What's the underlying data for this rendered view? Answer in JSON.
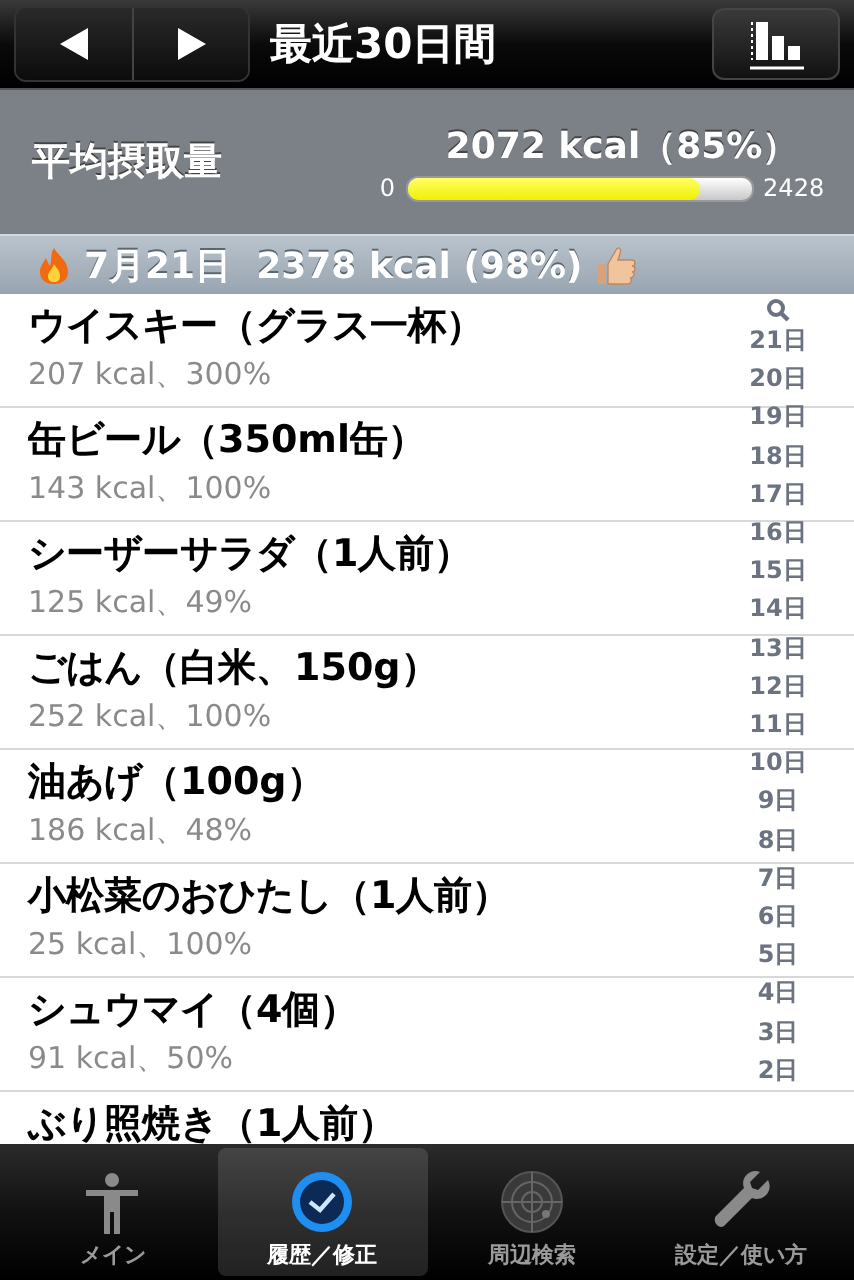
{
  "nav_bar": {
    "title": "最近30日間"
  },
  "summary": {
    "label": "平均摂取量",
    "value": "2072 kcal（85%）",
    "min": "0",
    "max": "2428",
    "level": 0.85
  },
  "section": {
    "title": "7月21日  2378 kcal (98%)"
  },
  "items": [
    {
      "name": "ウイスキー（グラス一杯）",
      "detail": "207 kcal、300%"
    },
    {
      "name": "缶ビール（350ml缶）",
      "detail": "143 kcal、100%"
    },
    {
      "name": "シーザーサラダ（1人前）",
      "detail": "125 kcal、49%"
    },
    {
      "name": "ごはん（白米、150g）",
      "detail": "252 kcal、100%"
    },
    {
      "name": "油あげ（100g）",
      "detail": "186 kcal、48%"
    },
    {
      "name": "小松菜のおひたし（1人前）",
      "detail": "25 kcal、100%"
    },
    {
      "name": "シュウマイ（4個）",
      "detail": "91 kcal、50%"
    },
    {
      "name": "ぶり照焼き（1人前）"
    }
  ],
  "index": [
    "21日",
    "20日",
    "19日",
    "18日",
    "17日",
    "16日",
    "15日",
    "14日",
    "13日",
    "12日",
    "11日",
    "10日",
    "9日",
    "8日",
    "7日",
    "6日",
    "5日",
    "4日",
    "3日",
    "2日"
  ],
  "tab_bar": [
    {
      "label": "メイン",
      "selected": false
    },
    {
      "label": "履歴／修正",
      "selected": true
    },
    {
      "label": "周辺検索",
      "selected": false
    },
    {
      "label": "設定／使い方",
      "selected": false
    }
  ]
}
